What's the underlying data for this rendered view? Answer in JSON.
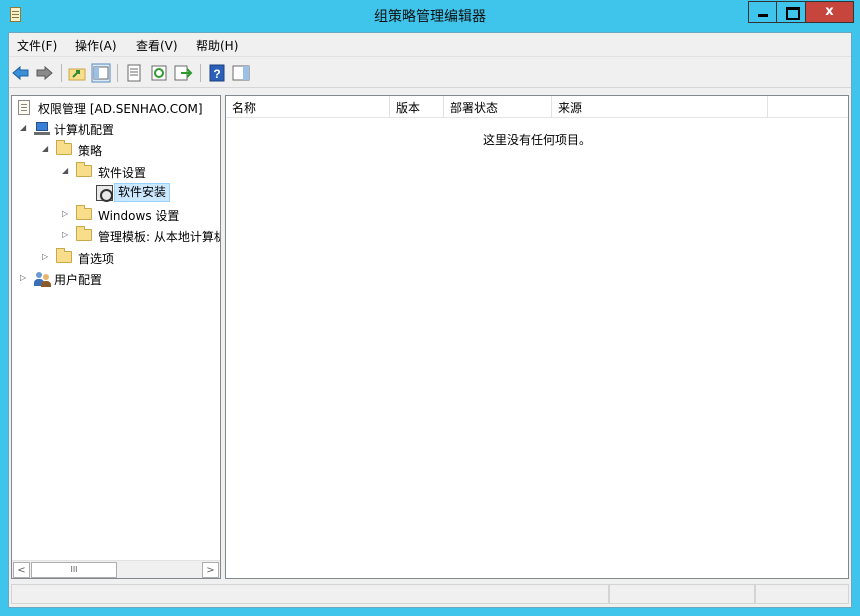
{
  "window": {
    "title": "组策略管理编辑器",
    "controls": {
      "minimize": "minimize",
      "maximize": "maximize",
      "close_label": "x",
      "close_color": "#c6463d"
    },
    "titlebar_color": "#3fc4eb"
  },
  "menubar": {
    "items": [
      {
        "label": "文件(F)"
      },
      {
        "label": "操作(A)"
      },
      {
        "label": "查看(V)"
      },
      {
        "label": "帮助(H)"
      }
    ]
  },
  "toolbar": {
    "buttons": [
      {
        "icon": "back-arrow-icon"
      },
      {
        "icon": "forward-arrow-icon"
      },
      {
        "icon": "up-folder-icon"
      },
      {
        "icon": "show-hide-tree-icon"
      },
      {
        "icon": "properties-icon"
      },
      {
        "icon": "refresh-icon"
      },
      {
        "icon": "export-list-icon"
      },
      {
        "icon": "help-icon"
      },
      {
        "icon": "show-hide-action-pane-icon"
      }
    ]
  },
  "tree": {
    "items": [
      {
        "label": "权限管理 [AD.SENHAO.COM]",
        "icon": "policy-doc-icon",
        "expander": ""
      },
      {
        "label": "计算机配置",
        "icon": "computer-icon",
        "expander": "◢"
      },
      {
        "label": "策略",
        "icon": "folder-icon",
        "expander": "◢"
      },
      {
        "label": "软件设置",
        "icon": "folder-icon",
        "expander": "◢"
      },
      {
        "label": "软件安装",
        "icon": "software-install-icon",
        "expander": "",
        "selected": true
      },
      {
        "label": "Windows 设置",
        "icon": "folder-icon",
        "expander": "▷"
      },
      {
        "label": "管理模板: 从本地计算机",
        "icon": "folder-icon",
        "expander": "▷"
      },
      {
        "label": "首选项",
        "icon": "folder-icon",
        "expander": "▷"
      },
      {
        "label": "用户配置",
        "icon": "users-icon",
        "expander": "▷"
      }
    ],
    "scrollbar": {
      "left_arrow": "<",
      "thumb_grip": "III",
      "right_arrow": ">"
    }
  },
  "list": {
    "columns": [
      {
        "label": "名称"
      },
      {
        "label": "版本"
      },
      {
        "label": "部署状态"
      },
      {
        "label": "来源"
      },
      {
        "label": ""
      }
    ],
    "empty_message": "这里没有任何项目。"
  },
  "statusbar": {
    "cells": [
      "",
      "",
      ""
    ]
  }
}
